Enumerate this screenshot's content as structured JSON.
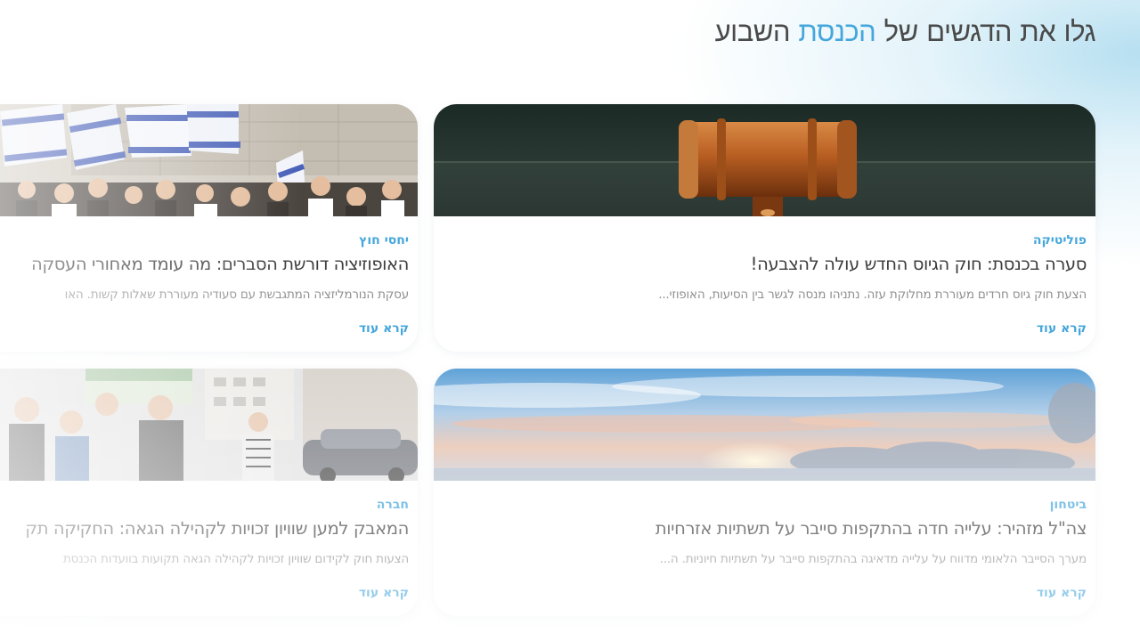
{
  "heading": {
    "part_before": "גלו את הדגשים של ",
    "accent": "הכנסת",
    "part_after": " השבוע",
    "accent_color": "#45a6dc"
  },
  "cards": [
    {
      "category": "פוליטיקה",
      "title": "סערה בכנסת: חוק הגיוס החדש עולה להצבעה!",
      "excerpt": "הצעת חוק גיוס חרדים מעוררת מחלוקת עזה. נתניהו מנסה לגשר בין הסיעות, האופוזי...",
      "read_more": "קרא עוד",
      "image": "gavel-photo"
    },
    {
      "category": "יחסי חוץ",
      "title": "האופוזיציה דורשת הסברים: מה עומד מאחורי העסקה",
      "excerpt": "עסקת הנורמליזציה המתגבשת עם סעודיה מעוררת שאלות קשות. האו",
      "read_more": "קרא עוד",
      "image": "flag-march-photo"
    },
    {
      "category": "ביטחון",
      "title": "צה\"ל מזהיר: עלייה חדה בהתקפות סייבר על תשתיות אזרחיות",
      "excerpt": "מערך הסייבר הלאומי מדווח על עלייה מדאיגה בהתקפות סייבר על תשתיות חיוניות. ה...",
      "read_more": "קרא עוד",
      "image": "sunset-sky-photo"
    },
    {
      "category": "חברה",
      "title": "המאבק למען שוויון זכויות לקהילה הגאה: החקיקה תק",
      "excerpt": "הצעות חוק לקידום שוויון זכויות לקהילה הגאה תקועות בוועדות הכנסת",
      "read_more": "קרא עוד",
      "image": "street-crowd-photo"
    }
  ],
  "colors": {
    "accent": "#45a6dc",
    "title": "#3d3d3d",
    "excerpt": "#8f8f8f"
  }
}
